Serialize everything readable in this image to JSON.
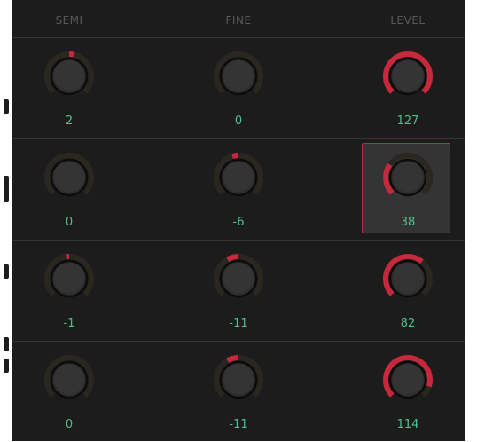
{
  "columns": [
    "SEMI",
    "FINE",
    "LEVEL"
  ],
  "colors": {
    "background": "#1c1c1c",
    "track": "#2a2620",
    "accent": "#c8283c",
    "value_text": "#4fbf8f",
    "header_text": "#585858"
  },
  "rows": [
    {
      "semi": {
        "value": "2",
        "min": -24,
        "max": 24,
        "v": 2
      },
      "fine": {
        "value": "0",
        "min": -50,
        "max": 50,
        "v": 0
      },
      "level": {
        "value": "127",
        "min": 0,
        "max": 127,
        "v": 127
      }
    },
    {
      "semi": {
        "value": "0",
        "min": -24,
        "max": 24,
        "v": 0
      },
      "fine": {
        "value": "-6",
        "min": -50,
        "max": 50,
        "v": -6
      },
      "level": {
        "value": "38",
        "min": 0,
        "max": 127,
        "v": 38,
        "selected": true
      }
    },
    {
      "semi": {
        "value": "-1",
        "min": -24,
        "max": 24,
        "v": -1
      },
      "fine": {
        "value": "-11",
        "min": -50,
        "max": 50,
        "v": -11
      },
      "level": {
        "value": "82",
        "min": 0,
        "max": 127,
        "v": 82
      }
    },
    {
      "semi": {
        "value": "0",
        "min": -24,
        "max": 24,
        "v": 0
      },
      "fine": {
        "value": "-11",
        "min": -50,
        "max": 50,
        "v": -11
      },
      "level": {
        "value": "114",
        "min": 0,
        "max": 127,
        "v": 114
      }
    }
  ]
}
